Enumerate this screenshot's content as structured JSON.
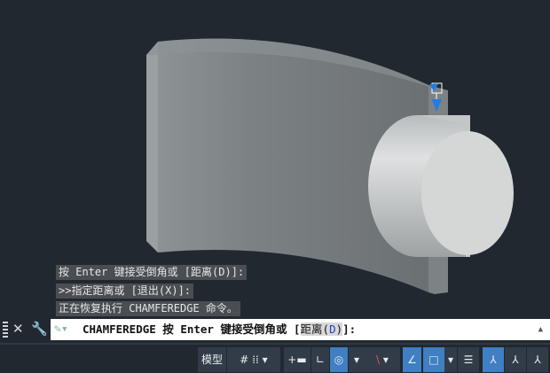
{
  "history": [
    "按 Enter 键接受倒角或 [距离(D)]:",
    ">>指定距离或 [退出(X)]:",
    "正在恢复执行 CHAMFEREDGE 命令。"
  ],
  "command_line": {
    "command": "CHAMFEREDGE 按 Enter 键接受倒角或 [",
    "option": "距离(",
    "option_key": "D",
    "option_close": ")",
    "suffix": "]:"
  },
  "status_bar": {
    "model_label": "模型"
  },
  "colors": {
    "background": "#212830",
    "accent": "#3f7fc2",
    "grip": "#1e7de8"
  }
}
